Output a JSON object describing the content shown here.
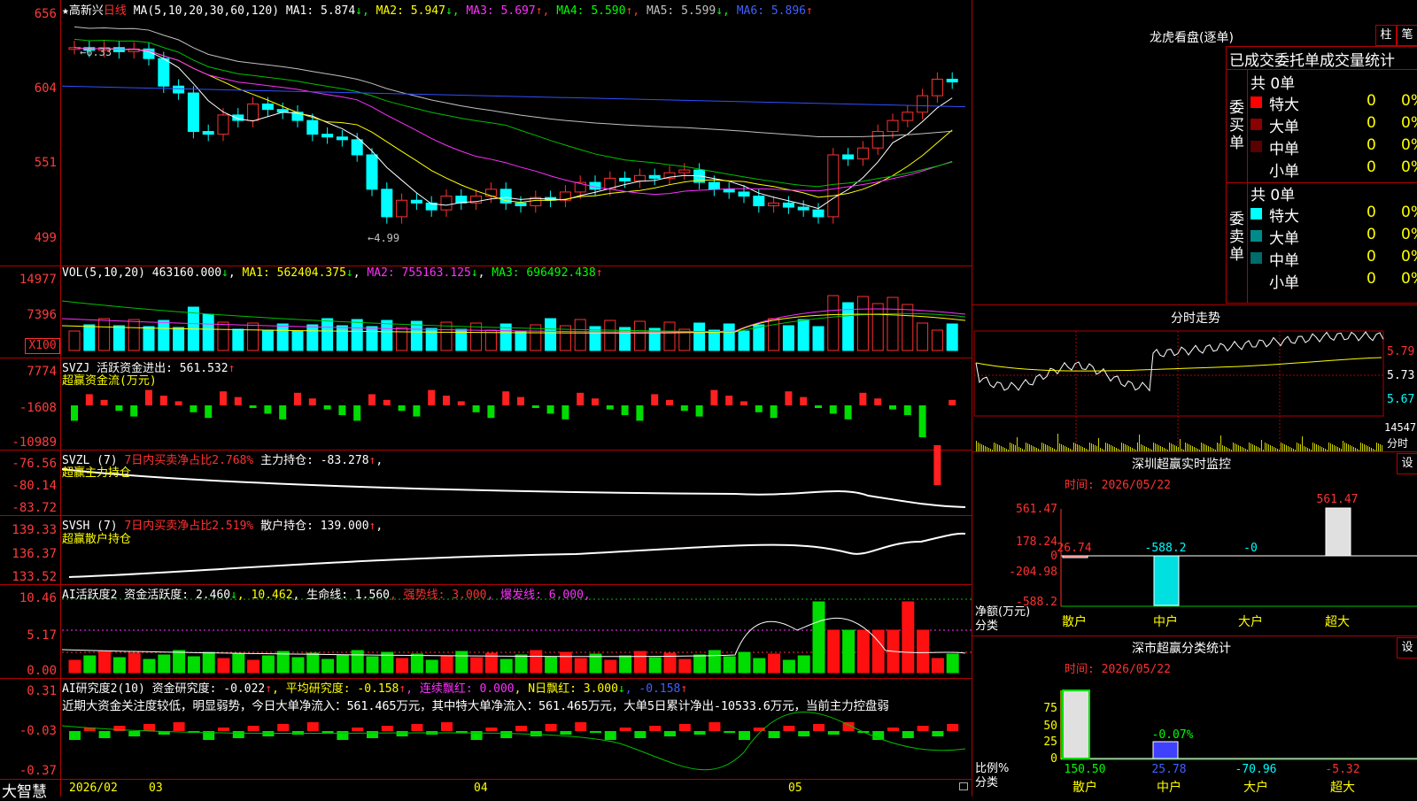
{
  "stock": {
    "star": "★",
    "name": "高新兴",
    "period": "日线",
    "ma_label": "MA(5,10,20,30,60,120)",
    "ma": [
      {
        "label": "MA1: 5.874",
        "arrow": "↓",
        "color": "#ffffff"
      },
      {
        "label": "MA2: 5.947",
        "arrow": "↓",
        "color": "#ffff00"
      },
      {
        "label": "MA3: 5.697",
        "arrow": "↑",
        "color": "#ff30ff"
      },
      {
        "label": "MA4: 5.590",
        "arrow": "↑",
        "color": "#00ff00"
      },
      {
        "label": "MA5: 5.599",
        "arrow": "↓",
        "color": "#c0c0c0"
      },
      {
        "label": "MA6: 5.896",
        "arrow": "↑",
        "color": "#4060ff"
      }
    ],
    "high_mark": "6.33",
    "low_mark": "4.99",
    "price_axis": [
      "656",
      "604",
      "551",
      "499"
    ]
  },
  "vol": {
    "title": "VOL(5,10,20)",
    "value": "463160.000",
    "value_arrow": "↓",
    "ma1": "MA1: 562404.375",
    "ma1_arrow": "↓",
    "ma2": "MA2: 755163.125",
    "ma2_arrow": "↓",
    "ma3": "MA3: 696492.438",
    "ma3_arrow": "↑",
    "axis": [
      "14977",
      "7396"
    ],
    "unit": "X100"
  },
  "svzj": {
    "title": "SVZJ  活跃资金进出: 561.532",
    "arrow": "↑",
    "subtitle": "超赢资金流(万元)",
    "axis": [
      "7774",
      "-1608",
      "-10989"
    ]
  },
  "svzl": {
    "title": "SVZL (7)",
    "ratio": "7日内买卖净占比2.768%",
    "hold": "主力持仓: -83.278",
    "arrow": "↑",
    "comma": ",",
    "subtitle": "超赢主力持仓",
    "axis": [
      "-76.56",
      "-80.14",
      "-83.72"
    ]
  },
  "svsh": {
    "title": "SVSH (7)",
    "ratio": "7日内买卖净占比2.519%",
    "hold": "散户持仓: 139.000",
    "arrow": "↑",
    "comma": ",",
    "subtitle": "超赢散户持仓",
    "axis": [
      "139.33",
      "136.37",
      "133.52"
    ]
  },
  "ai_active": {
    "title": "AI活跃度2 资金活跃度: 2.460",
    "arrow1": "↓",
    "v2": ", 10.462",
    "life": ", 生命线: 1.560",
    "strong": ", 强势线: 3.000",
    "burst": ", 爆发线: 6.000,",
    "axis": [
      "10.46",
      "5.17",
      "0.00"
    ]
  },
  "ai_research": {
    "title": "AI研究度2(10)",
    "res": "资金研究度: -0.022",
    "arrow": "↑",
    "avg": ", 平均研究度: -0.158",
    "avg_arrow": "↑",
    "cont": ", 连续飘红: 0.000",
    "nday": ", N日飘红: 3.000",
    "nday_arrow": "↓",
    "last": ", -0.158",
    "last_arrow": "↑",
    "comment": "近期大资金关注度较低，明显弱势，今日大单净流入：561.465万元，其中特大单净流入：561.465万元，大单5日累计净出-10533.6万元，当前主力控盘弱",
    "axis": [
      "0.31",
      "-0.03",
      "-0.37"
    ]
  },
  "bottom": {
    "brand": "大智慧",
    "dates": [
      "2026/02",
      "03",
      "04",
      "05"
    ]
  },
  "right": {
    "lhkp_title": "龙虎看盘(逐单)",
    "btn1": "柱",
    "btn2": "笔",
    "tabs": "已成交委托单成交量统计",
    "buy_label": "委买单",
    "sell_label": "委卖单",
    "buy_total": "共 0单",
    "sell_total": "共 0单",
    "buy_rows": [
      {
        "name": "特大",
        "color": "#ff0000",
        "v": "0",
        "p": "0%"
      },
      {
        "name": "大单",
        "color": "#8b0000",
        "v": "0",
        "p": "0%"
      },
      {
        "name": "中单",
        "color": "#5a0000",
        "v": "0",
        "p": "0%"
      },
      {
        "name": "小单",
        "color": "#000000",
        "v": "0",
        "p": "0%"
      }
    ],
    "sell_rows": [
      {
        "name": "特大",
        "color": "#00ffff",
        "v": "0",
        "p": "0%"
      },
      {
        "name": "大单",
        "color": "#008b8b",
        "v": "0",
        "p": "0%"
      },
      {
        "name": "中单",
        "color": "#006b6b",
        "v": "0",
        "p": "0%"
      },
      {
        "name": "小单",
        "color": "#000000",
        "v": "0",
        "p": "0%"
      }
    ],
    "fs_title": "分时走势",
    "fs_axis": [
      "5.79",
      "5.73",
      "5.67",
      "14547"
    ],
    "fs_unit": "分时",
    "sz_title": "深圳超赢实时监控",
    "sz_btn": "设",
    "sz_time": "时间: 2026/05/22",
    "sz_axis": [
      "561.47",
      "178.24",
      "0",
      "-204.98",
      "-588.2"
    ],
    "sz_yunit": "净额(万元)",
    "sz_xunit": "分类",
    "sz_cats": [
      "散户",
      "中户",
      "大户",
      "超大"
    ],
    "sz_vals": [
      "26.74",
      "-588.2",
      "-0",
      "561.47"
    ],
    "sc_title": "深市超赢分类统计",
    "sc_btn": "设",
    "sc_time": "时间: 2026/05/22",
    "sc_axis": [
      "75",
      "50",
      "25",
      "0"
    ],
    "sc_yunit": "比例%",
    "sc_xunit": "分类",
    "sc_cats": [
      "散户",
      "中户",
      "大户",
      "超大"
    ],
    "sc_vals": [
      "150.50",
      "25.78",
      "-70.96",
      "-5.32"
    ],
    "sc_mid_label": "-0.07%"
  }
}
